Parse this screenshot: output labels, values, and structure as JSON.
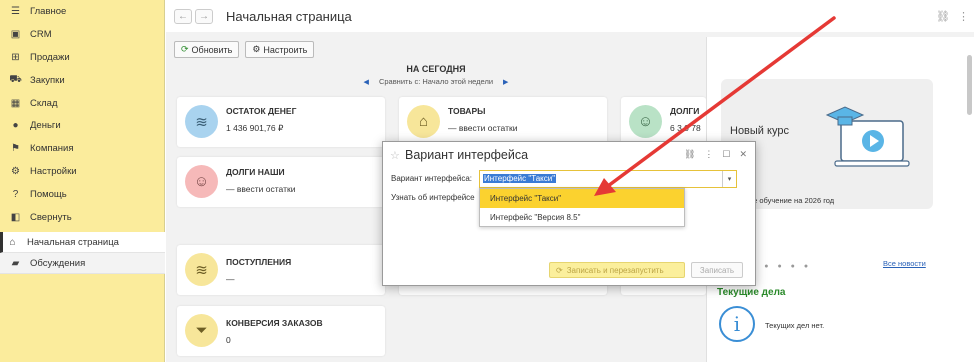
{
  "sidebar": {
    "items": [
      {
        "label": "Главное",
        "icon": "menu-icon",
        "glyph": "☰"
      },
      {
        "label": "CRM",
        "icon": "contacts-icon",
        "glyph": "▣"
      },
      {
        "label": "Продажи",
        "icon": "basket-icon",
        "glyph": "⊞"
      },
      {
        "label": "Закупки",
        "icon": "truck-icon",
        "glyph": "⛟"
      },
      {
        "label": "Склад",
        "icon": "warehouse-icon",
        "glyph": "▦"
      },
      {
        "label": "Деньги",
        "icon": "coin-icon",
        "glyph": "●"
      },
      {
        "label": "Компания",
        "icon": "flag-icon",
        "glyph": "⚑"
      },
      {
        "label": "Настройки",
        "icon": "gear-icon",
        "glyph": "⚙"
      },
      {
        "label": "Помощь",
        "icon": "help-icon",
        "glyph": "?"
      },
      {
        "label": "Свернуть",
        "icon": "collapse-icon",
        "glyph": "◧"
      }
    ],
    "bottom": [
      {
        "label": "Начальная страница",
        "icon": "home-icon",
        "glyph": "⌂"
      },
      {
        "label": "Обсуждения",
        "icon": "chat-icon",
        "glyph": "▰"
      }
    ]
  },
  "header": {
    "title": "Начальная страница",
    "back_glyph": "←",
    "forward_glyph": "→",
    "link_glyph": "🔗",
    "more_glyph": "⋮"
  },
  "toolbar": {
    "refresh_label": "Обновить",
    "settings_label": "Настроить"
  },
  "today": {
    "heading": "НА СЕГОДНЯ",
    "compare": "Сравнить с: Начало этой недели"
  },
  "cards": {
    "cash": {
      "title": "ОСТАТОК ДЕНЕГ",
      "value": "1 436 901,76 ₽"
    },
    "goods": {
      "title": "ТОВАРЫ",
      "value": "—     ввести остатки"
    },
    "debts_theirs": {
      "title": "ДОЛГИ",
      "value": "6 3 0 78"
    },
    "debts_ours": {
      "title": "ДОЛГИ НАШИ",
      "value": "—     ввести остатки"
    },
    "receipts": {
      "title": "ПОСТУПЛЕНИЯ",
      "value": "—"
    },
    "conversion": {
      "title": "КОНВЕРСИЯ ЗАКАЗОВ",
      "value": "0"
    }
  },
  "right_panel": {
    "promo_title": "Новый курс",
    "promo_text": "е свое обучение на 2026 год",
    "all_news": "Все новости",
    "tasks_title": "Текущие дела",
    "no_tasks": "Текущих дел нет."
  },
  "dialog": {
    "title": "Вариант интерфейса",
    "field_label": "Вариант интерфейса:",
    "field_value": "Интерфейс \"Такси\"",
    "about_label": "Узнать об интерфейсе",
    "options": [
      "Интерфейс \"Такси\"",
      "Интерфейс \"Версия 8.5\""
    ],
    "save_restart": "Записать и перезапустить",
    "save": "Записать"
  },
  "colors": {
    "sidebar_bg": "#fbec9c",
    "accent_yellow": "#fbd22f",
    "link_blue": "#2a62b8",
    "tasks_green": "#2a8a2a",
    "arrow_red": "#e53935"
  }
}
